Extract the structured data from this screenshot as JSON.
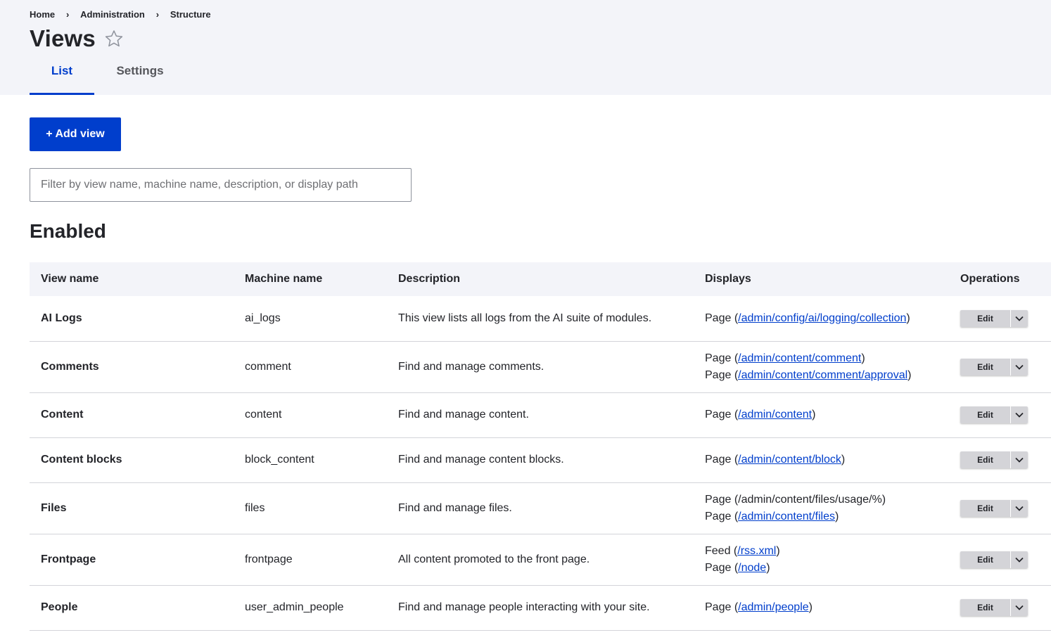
{
  "breadcrumb": [
    "Home",
    "Administration",
    "Structure"
  ],
  "breadcrumb_separator": "›",
  "page": {
    "title": "Views"
  },
  "tabs": [
    {
      "label": "List",
      "active": true
    },
    {
      "label": "Settings",
      "active": false
    }
  ],
  "actions": {
    "add_view_label": "+ Add view"
  },
  "filter": {
    "placeholder": "Filter by view name, machine name, description, or display path",
    "value": ""
  },
  "section": {
    "enabled_title": "Enabled"
  },
  "table": {
    "headers": [
      "View name",
      "Machine name",
      "Description",
      "Displays",
      "Operations"
    ],
    "edit_label": "Edit",
    "rows": [
      {
        "name": "AI Logs",
        "machine": "ai_logs",
        "description": "This view lists all logs from the AI suite of modules.",
        "displays": [
          {
            "type": "Page",
            "path": "/admin/config/ai/logging/collection",
            "link": true
          }
        ]
      },
      {
        "name": "Comments",
        "machine": "comment",
        "description": "Find and manage comments.",
        "displays": [
          {
            "type": "Page",
            "path": "/admin/content/comment",
            "link": true
          },
          {
            "type": "Page",
            "path": "/admin/content/comment/approval",
            "link": true
          }
        ]
      },
      {
        "name": "Content",
        "machine": "content",
        "description": "Find and manage content.",
        "displays": [
          {
            "type": "Page",
            "path": "/admin/content",
            "link": true
          }
        ]
      },
      {
        "name": "Content blocks",
        "machine": "block_content",
        "description": "Find and manage content blocks.",
        "displays": [
          {
            "type": "Page",
            "path": "/admin/content/block",
            "link": true
          }
        ]
      },
      {
        "name": "Files",
        "machine": "files",
        "description": "Find and manage files.",
        "displays": [
          {
            "type": "Page",
            "path": "/admin/content/files/usage/%",
            "link": false
          },
          {
            "type": "Page",
            "path": "/admin/content/files",
            "link": true
          }
        ]
      },
      {
        "name": "Frontpage",
        "machine": "frontpage",
        "description": "All content promoted to the front page.",
        "displays": [
          {
            "type": "Feed",
            "path": "/rss.xml",
            "link": true
          },
          {
            "type": "Page",
            "path": "/node",
            "link": true
          }
        ]
      },
      {
        "name": "People",
        "machine": "user_admin_people",
        "description": "Find and manage people interacting with your site.",
        "displays": [
          {
            "type": "Page",
            "path": "/admin/people",
            "link": true
          }
        ]
      }
    ]
  },
  "colors": {
    "accent": "#003ecc",
    "header_bg": "#f3f4f9",
    "text": "#232429"
  }
}
